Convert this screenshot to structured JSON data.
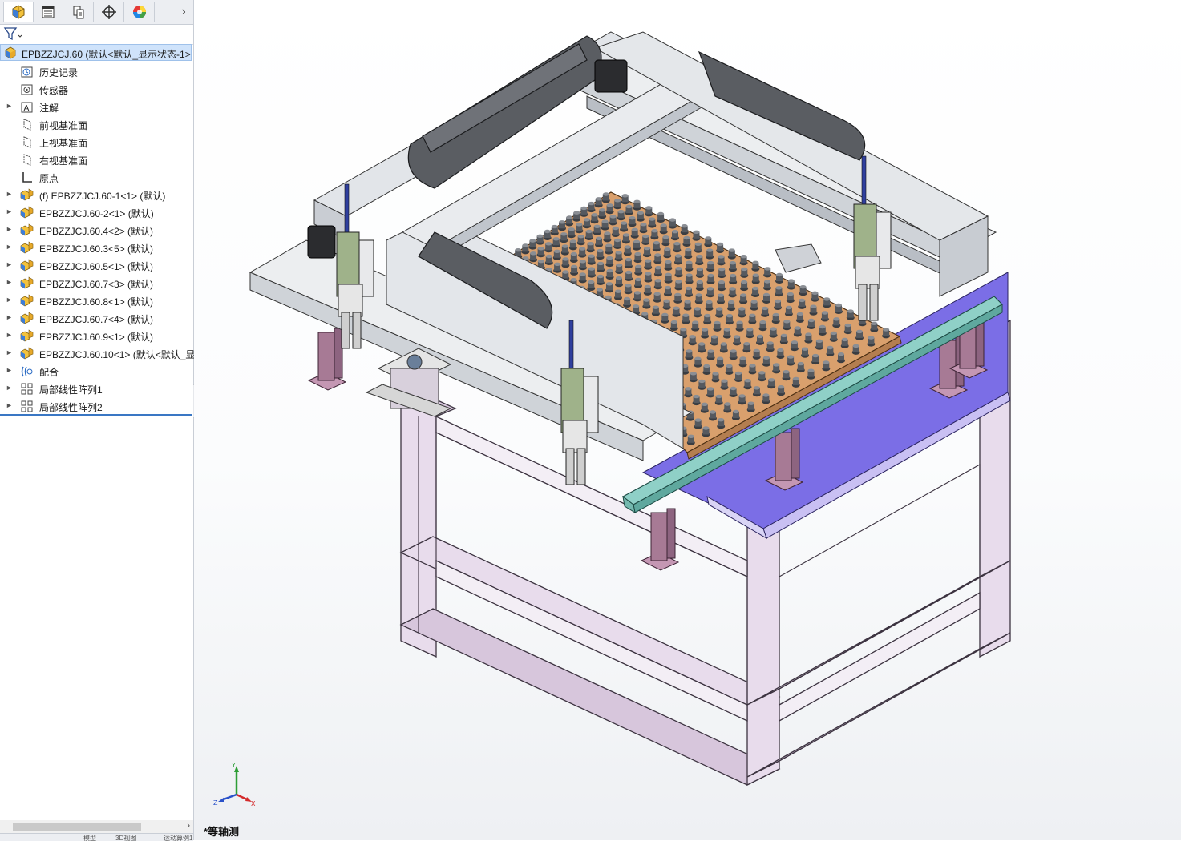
{
  "panel": {
    "tabs": [
      {
        "icon": "feature-manager-icon",
        "active": true
      },
      {
        "icon": "property-manager-icon",
        "active": false
      },
      {
        "icon": "configuration-manager-icon",
        "active": false
      },
      {
        "icon": "dimxpert-manager-icon",
        "active": false
      },
      {
        "icon": "display-manager-icon",
        "active": false
      }
    ],
    "expand_glyph": "›",
    "filter_icon": "filter-icon",
    "root": {
      "label": "EPBZZJCJ.60  (默认<默认_显示状态-1>",
      "icon": "assembly-icon"
    },
    "items": [
      {
        "label": "历史记录",
        "icon": "history-icon",
        "expandable": false
      },
      {
        "label": "传感器",
        "icon": "sensor-icon",
        "expandable": false
      },
      {
        "label": "注解",
        "icon": "annotation-icon",
        "expandable": true
      },
      {
        "label": "前视基准面",
        "icon": "plane-icon",
        "expandable": false
      },
      {
        "label": "上视基准面",
        "icon": "plane-icon",
        "expandable": false
      },
      {
        "label": "右视基准面",
        "icon": "plane-icon",
        "expandable": false
      },
      {
        "label": "原点",
        "icon": "origin-icon",
        "expandable": false
      },
      {
        "label": "(f) EPBZZJCJ.60-1<1> (默认)",
        "icon": "subassembly-icon",
        "expandable": true
      },
      {
        "label": "EPBZZJCJ.60-2<1> (默认)",
        "icon": "subassembly-icon",
        "expandable": true
      },
      {
        "label": "EPBZZJCJ.60.4<2> (默认)",
        "icon": "subassembly-icon",
        "expandable": true
      },
      {
        "label": "EPBZZJCJ.60.3<5> (默认)",
        "icon": "subassembly-icon",
        "expandable": true
      },
      {
        "label": "EPBZZJCJ.60.5<1> (默认)",
        "icon": "subassembly-icon",
        "expandable": true
      },
      {
        "label": "EPBZZJCJ.60.7<3> (默认)",
        "icon": "subassembly-icon",
        "expandable": true
      },
      {
        "label": "EPBZZJCJ.60.8<1> (默认)",
        "icon": "subassembly-icon",
        "expandable": true
      },
      {
        "label": "EPBZZJCJ.60.7<4> (默认)",
        "icon": "subassembly-icon",
        "expandable": true
      },
      {
        "label": "EPBZZJCJ.60.9<1> (默认)",
        "icon": "subassembly-icon",
        "expandable": true
      },
      {
        "label": "EPBZZJCJ.60.10<1> (默认<默认_显",
        "icon": "subassembly-icon",
        "expandable": true
      },
      {
        "label": "配合",
        "icon": "mates-icon",
        "expandable": true
      },
      {
        "label": "局部线性阵列1",
        "icon": "linear-pattern-icon",
        "expandable": true
      },
      {
        "label": "局部线性阵列2",
        "icon": "linear-pattern-icon",
        "expandable": true
      }
    ],
    "bottom_tabs": [
      "模型",
      "3D视图",
      "运动算例1"
    ]
  },
  "viewport": {
    "view_name": "*等轴测",
    "triad": {
      "x": "X",
      "y": "Y",
      "z": "Z"
    },
    "colors": {
      "frame": "#e8dcec",
      "base_plate": "#7b6ee6",
      "tray": "#d9a06d",
      "cups": "#3a3d42",
      "rail": "#d3d6da",
      "cable_chain": "#5a5d62",
      "side_rail": "#8fd0c7",
      "post": "#a77a95"
    }
  }
}
